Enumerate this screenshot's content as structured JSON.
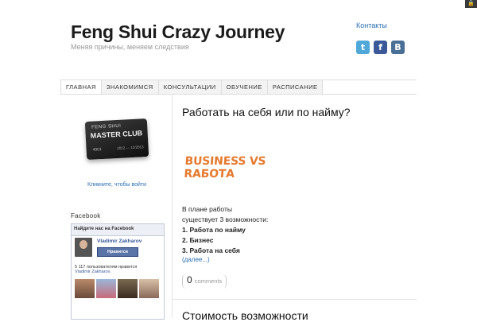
{
  "site": {
    "title": "Feng Shui Crazy Journey",
    "tagline": "Меняя причины, меняем следствия"
  },
  "header": {
    "contacts_link": "Контакты",
    "social": [
      {
        "name": "twitter-icon",
        "glyph": "t",
        "color": "#4fa8d8"
      },
      {
        "name": "facebook-icon",
        "glyph": "f",
        "color": "#3b5998"
      },
      {
        "name": "vkontakte-icon",
        "glyph": "B",
        "color": "#4a6f96"
      }
    ]
  },
  "nav": {
    "items": [
      "ГЛАВНАЯ",
      "ЗНАКОМИМСЯ",
      "КОНСУЛЬТАЦИИ",
      "ОБУЧЕНИЕ",
      "РАСПИСАНИЕ"
    ],
    "active_index": 0
  },
  "sidebar": {
    "card": {
      "line1": "FENG SHUI",
      "line2": "MASTER CLUB",
      "number": "4901",
      "validity": "2012 — 12/2013"
    },
    "login_link": "Кликните, чтобы войти",
    "facebook": {
      "section_title": "Facebook",
      "widget_header": "Найдите нас на Facebook",
      "page_name": "Vladimir Zakharov",
      "like_button": "Нравится",
      "likes_text": "5 117 пользователям нравится",
      "likes_name": "Vladimir Zakharov."
    }
  },
  "main": {
    "post1": {
      "title": "Работать на себя или по найму?",
      "image_text": "BUSINESS VS RAБОТА",
      "lines": [
        "В плане работы",
        "существует 3 возможности:"
      ],
      "list": [
        "1. Работа по найму",
        "2. Бизнес",
        "3. Работа на себя"
      ],
      "more_link": "(далее...)",
      "comments_count": "0",
      "comments_label": "comments"
    },
    "post2": {
      "title": "Стоимость возможности"
    }
  },
  "colors": {
    "link": "#2a6db0",
    "image_text": "#e57a2f",
    "facebook": "#3b5998"
  }
}
